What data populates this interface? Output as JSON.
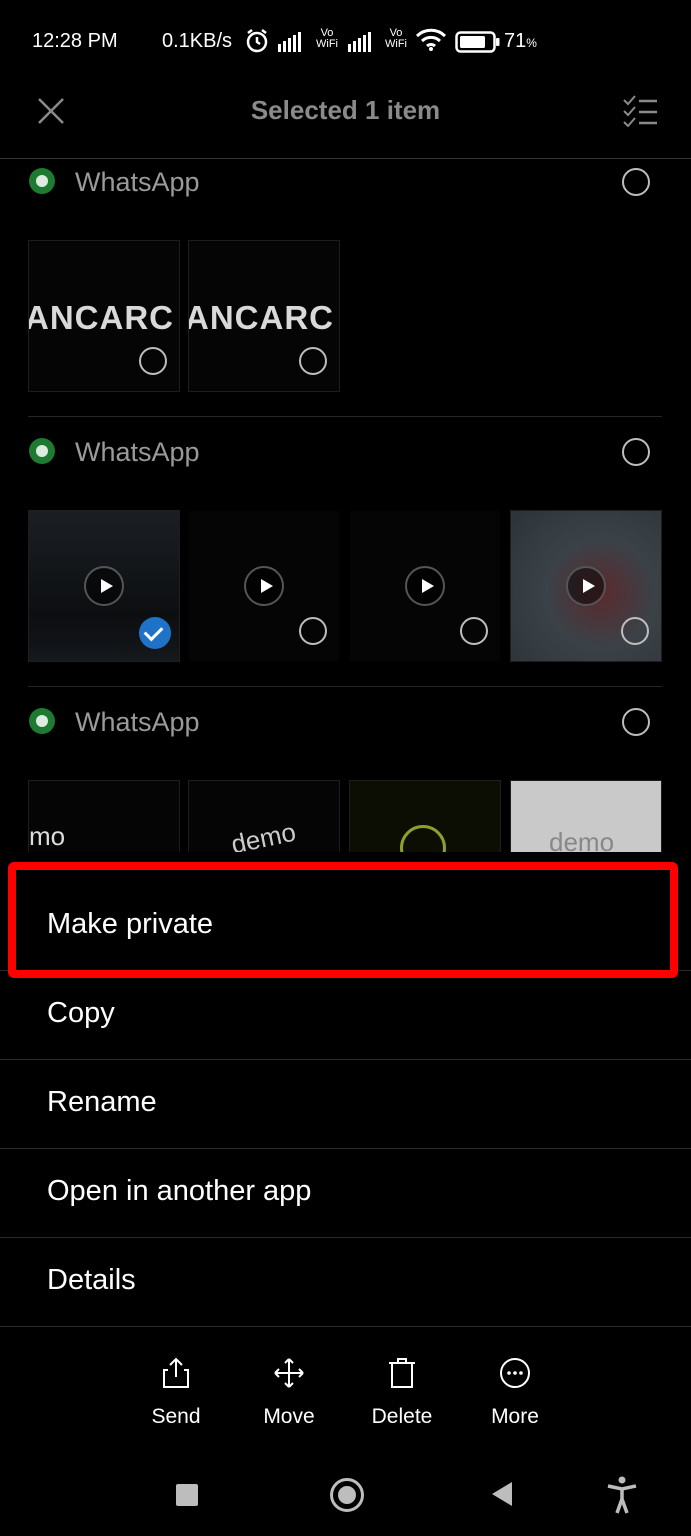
{
  "status_bar": {
    "time": "12:28 PM",
    "speed": "0.1KB/s",
    "vo_wifi_1": "Vo WiFi",
    "vo_wifi_2": "Vo WiFi",
    "battery_percent": "71",
    "battery_unit": "%",
    "icons": [
      "alarm-icon",
      "signal-icon",
      "wifi-icon",
      "battery-icon"
    ]
  },
  "header": {
    "title": "Selected 1 item",
    "left_icon": "close-icon",
    "right_icon": "select-all-icon"
  },
  "groups": [
    {
      "title": "WhatsApp",
      "thumb_text": "ANCARC"
    },
    {
      "title": "WhatsApp"
    },
    {
      "title": "WhatsApp",
      "thumb_texts": [
        "mo",
        "demo",
        "demo"
      ]
    }
  ],
  "menu": {
    "items": [
      "Make private",
      "Copy",
      "Rename",
      "Open in another app",
      "Details"
    ]
  },
  "actions": [
    {
      "label": "Send",
      "icon": "share-icon"
    },
    {
      "label": "Move",
      "icon": "move-icon"
    },
    {
      "label": "Delete",
      "icon": "trash-icon"
    },
    {
      "label": "More",
      "icon": "more-icon"
    }
  ],
  "nav_bar": {
    "icons": [
      "recents-icon",
      "home-icon",
      "back-icon",
      "accessibility-icon"
    ]
  },
  "colors": {
    "highlight": "#ff0000",
    "checked": "#1e73c8",
    "whatsapp": "#1f7a31"
  }
}
